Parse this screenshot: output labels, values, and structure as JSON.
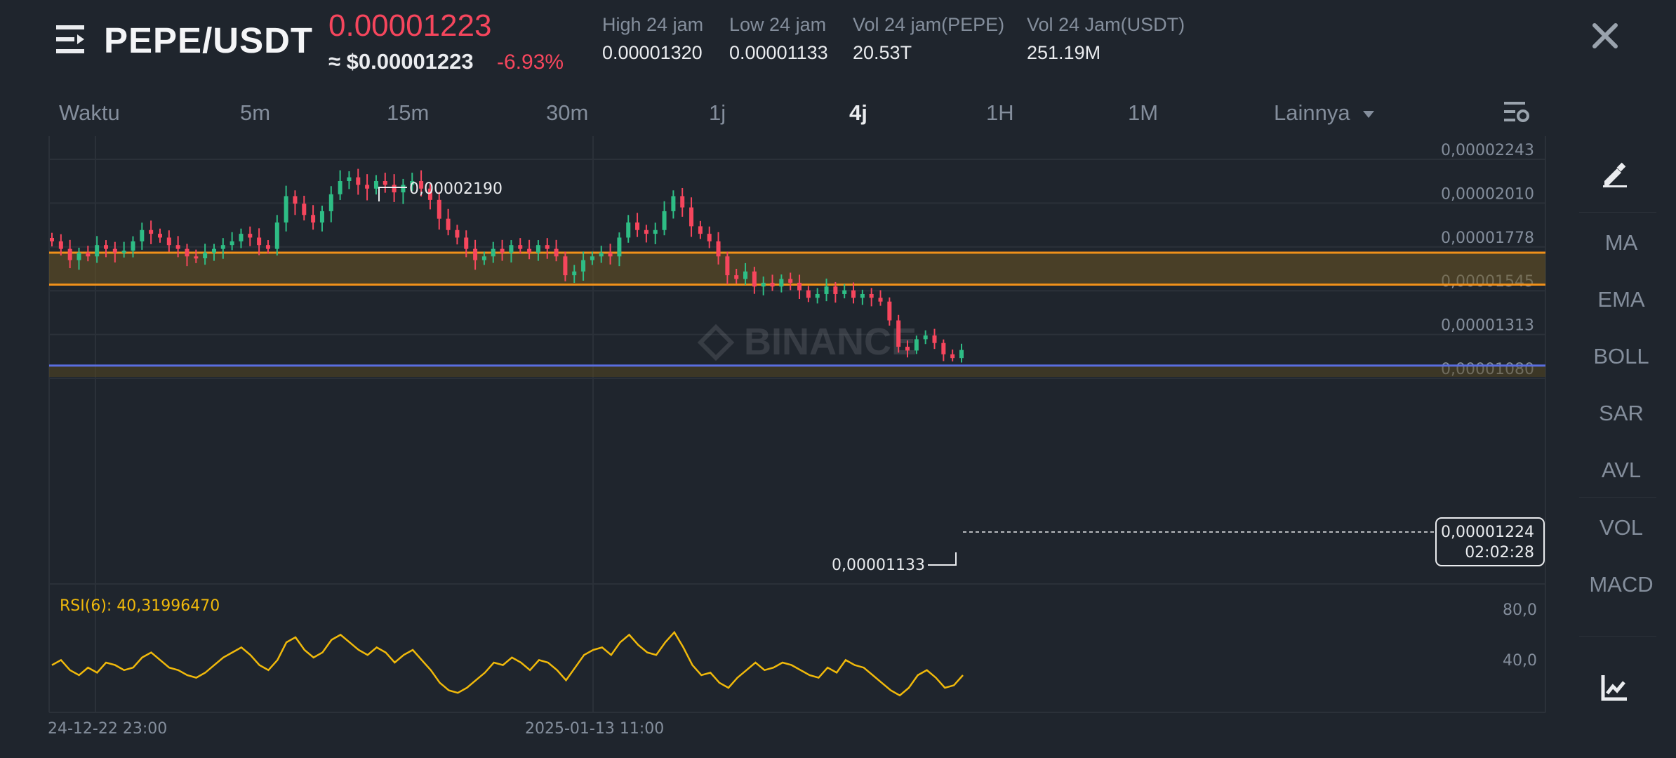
{
  "header": {
    "pair": "PEPE/USDT",
    "price": "0.00001223",
    "price_usd": "≈ $0.00001223",
    "change": "-6.93%",
    "stats": [
      {
        "label": "High 24 jam",
        "value": "0.00001320"
      },
      {
        "label": "Low 24 jam",
        "value": "0.00001133"
      },
      {
        "label": "Vol 24 jam(PEPE)",
        "value": "20.53T"
      },
      {
        "label": "Vol 24 Jam(USDT)",
        "value": "251.19M"
      }
    ]
  },
  "tabs": [
    "Waktu",
    "5m",
    "15m",
    "30m",
    "1j",
    "4j",
    "1H",
    "1M",
    "Lainnya"
  ],
  "active_tab": "4j",
  "right_toolbar": [
    "MA",
    "EMA",
    "BOLL",
    "SAR",
    "AVL",
    "VOL",
    "MACD"
  ],
  "icons": {
    "menu": "menu-icon",
    "close": "close-icon",
    "settings": "chart-settings-icon",
    "draw": "draw-pen-icon",
    "indicator": "indicator-chart-icon",
    "dropdown": "caret-down-icon"
  },
  "colors": {
    "up": "#2ebd85",
    "down": "#f6465d",
    "zone_line": "#f0901a",
    "support_line": "#5a6ee0",
    "rsi": "#f0b90b",
    "axis_text": "#848e9c"
  },
  "watermark": "BINANCE",
  "chart_data": {
    "type": "candlestick",
    "price_axis_labels": [
      "0,00002243",
      "0,00002010",
      "0,00001778",
      "0,00001545",
      "0,00001313",
      "0,00001080"
    ],
    "ylim": [
      1.08e-05,
      2.243e-05
    ],
    "high_marker": "0,00002190",
    "low_marker": "0,00001133",
    "last_price_label": "0,00001224",
    "countdown": "02:02:28",
    "zone": {
      "top": 1.74e-05,
      "bottom": 1.57e-05
    },
    "support": 1.14e-05,
    "lower_zone": {
      "top": 1.14e-05,
      "bottom": 1.08e-05
    },
    "close_series": [
      1.8,
      1.76,
      1.7,
      1.74,
      1.72,
      1.78,
      1.76,
      1.74,
      1.75,
      1.8,
      1.86,
      1.84,
      1.82,
      1.78,
      1.76,
      1.72,
      1.71,
      1.74,
      1.76,
      1.78,
      1.8,
      1.84,
      1.82,
      1.78,
      1.76,
      1.9,
      2.04,
      2.0,
      1.94,
      1.9,
      1.96,
      2.05,
      2.12,
      2.14,
      2.1,
      2.08,
      2.12,
      2.1,
      2.06,
      2.1,
      2.12,
      2.08,
      2.02,
      1.92,
      1.86,
      1.82,
      1.76,
      1.7,
      1.72,
      1.76,
      1.74,
      1.78,
      1.76,
      1.74,
      1.78,
      1.76,
      1.72,
      1.62,
      1.64,
      1.7,
      1.72,
      1.74,
      1.72,
      1.82,
      1.9,
      1.86,
      1.84,
      1.86,
      1.96,
      2.04,
      1.98,
      1.88,
      1.84,
      1.8,
      1.72,
      1.62,
      1.6,
      1.64,
      1.56,
      1.58,
      1.56,
      1.6,
      1.58,
      1.54,
      1.5,
      1.52,
      1.56,
      1.52,
      1.54,
      1.5,
      1.52,
      1.5,
      1.48,
      1.38,
      1.24,
      1.22,
      1.28,
      1.3,
      1.26,
      1.2,
      1.18,
      1.223
    ],
    "time_labels": [
      "24-12-22 23:00",
      "2025-01-13 11:00"
    ],
    "rsi": {
      "label": "RSI(6): 40,31996470",
      "axis_labels": [
        "80,0",
        "40,0"
      ],
      "values": [
        48,
        52,
        44,
        40,
        46,
        42,
        50,
        48,
        44,
        46,
        54,
        58,
        52,
        46,
        44,
        40,
        38,
        42,
        48,
        54,
        58,
        62,
        56,
        48,
        44,
        52,
        66,
        70,
        60,
        54,
        58,
        68,
        72,
        66,
        60,
        56,
        62,
        58,
        50,
        56,
        60,
        52,
        44,
        34,
        28,
        26,
        30,
        36,
        42,
        50,
        48,
        54,
        50,
        44,
        52,
        50,
        44,
        36,
        46,
        56,
        60,
        62,
        56,
        66,
        72,
        64,
        58,
        56,
        66,
        74,
        62,
        48,
        40,
        42,
        34,
        30,
        38,
        44,
        50,
        44,
        46,
        50,
        48,
        44,
        40,
        38,
        46,
        42,
        52,
        48,
        46,
        40,
        34,
        28,
        24,
        30,
        40,
        44,
        38,
        30,
        32,
        40
      ]
    }
  }
}
